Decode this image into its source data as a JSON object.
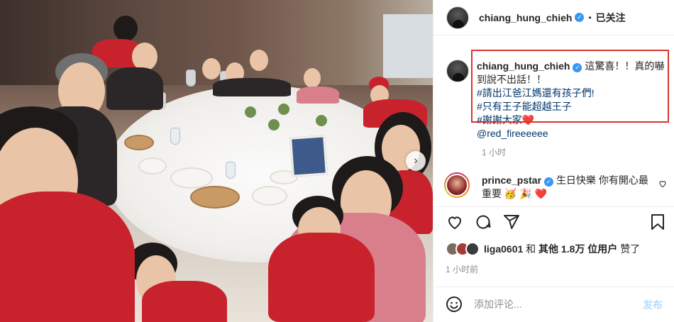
{
  "post_author": {
    "username": "chiang_hung_chieh",
    "verified": true,
    "separator": "•",
    "follow_status": "已关注"
  },
  "caption": {
    "username": "chiang_hung_chieh",
    "line1": "這驚喜！！真的嚇到說不出話！！",
    "hashtag1": "#請出江爸江媽還有孩子們!",
    "hashtag2": "#只有王子能超越王子",
    "hashtag3": "#謝謝大家",
    "heart": "❤️",
    "mention": "@red_fireeeeee",
    "time": "1 小时"
  },
  "comment": {
    "username": "prince_pstar",
    "text": "生日快樂 你有開心最重要",
    "emojis": "🥳 🎉 ❤️"
  },
  "actions": {
    "like_icon": "heart-icon",
    "comment_icon": "comment-icon",
    "share_icon": "share-icon",
    "save_icon": "bookmark-icon"
  },
  "likes": {
    "user": "liga0601",
    "connector": "和",
    "others": "其他 1.8万 位用户",
    "suffix": "赞了"
  },
  "post_time": "1 小时前",
  "composer": {
    "placeholder": "添加评论...",
    "post_label": "发布"
  },
  "colors": {
    "accent": "#3897f0",
    "highlight": "#d7362c",
    "hashtag": "#00376b",
    "post_disabled": "#b3dbff",
    "muted": "#8e8e8e"
  }
}
